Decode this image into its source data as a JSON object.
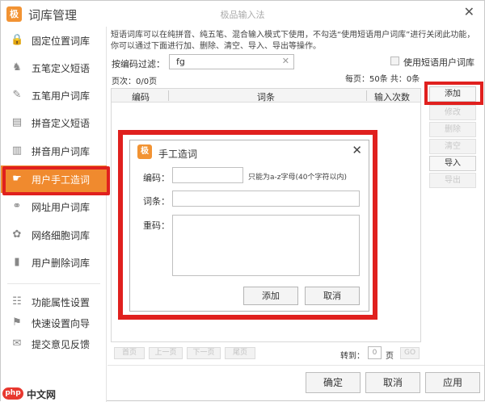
{
  "window": {
    "title": "词库管理",
    "logo": "极",
    "center_title": "极品输入法",
    "close_icon": "close-icon"
  },
  "sidebar": {
    "items": [
      {
        "label": "固定位置词库",
        "icon": "lock-icon",
        "glyph": "🔒"
      },
      {
        "label": "五笔定义短语",
        "icon": "person-icon",
        "glyph": "♞"
      },
      {
        "label": "五笔用户词库",
        "icon": "edit-icon",
        "glyph": "✎"
      },
      {
        "label": "拼音定义短语",
        "icon": "grid-icon",
        "glyph": "▤"
      },
      {
        "label": "拼音用户词库",
        "icon": "book-icon",
        "glyph": "▥"
      },
      {
        "label": "用户手工造词",
        "icon": "hand-icon",
        "glyph": "☛",
        "active": true
      },
      {
        "label": "网址用户词库",
        "icon": "link-icon",
        "glyph": "⚭"
      },
      {
        "label": "网络细胞词库",
        "icon": "cell-icon",
        "glyph": "✿"
      },
      {
        "label": "用户删除词库",
        "icon": "trash-icon",
        "glyph": "▮"
      },
      {
        "label": "功能属性设置",
        "icon": "settings-icon",
        "glyph": "☷"
      },
      {
        "label": "快速设置向导",
        "icon": "flag-icon",
        "glyph": "⚑"
      },
      {
        "label": "提交意见反馈",
        "icon": "feedback-icon",
        "glyph": "✉"
      }
    ],
    "colors": {
      "active_bg": "#f08a2e",
      "highlight": "#e0201e"
    }
  },
  "main": {
    "description": "短语词库可以在纯拼音、纯五笔、混合输入模式下使用，不勾选“使用短语用户词库”进行关闭此功能，你可以通过下面进行加、删除、清空、导入、导出等操作。",
    "filter_label": "按编码过滤：",
    "filter_value": "fg",
    "use_checkbox_label": "使用短语用户词库",
    "page_info": "页次：0/0页",
    "per_page": "每页：50条 共：0条",
    "columns": [
      "编码",
      "词条",
      "输入次数"
    ],
    "side_buttons": [
      {
        "label": "添加",
        "enabled": true
      },
      {
        "label": "修改",
        "enabled": false
      },
      {
        "label": "删除",
        "enabled": false
      },
      {
        "label": "清空",
        "enabled": false
      },
      {
        "label": "导入",
        "enabled": true
      },
      {
        "label": "导出",
        "enabled": false
      }
    ],
    "pager": {
      "first": "首页",
      "prev": "上一页",
      "next": "下一页",
      "last": "尾页",
      "goto_label": "转到：",
      "goto_value": "0",
      "page_word": "页",
      "go": "GO"
    }
  },
  "footer": {
    "ok": "确定",
    "cancel": "取消",
    "apply": "应用"
  },
  "dialog": {
    "title": "手工造词",
    "logo": "极",
    "code_label": "编码：",
    "code_hint": "只能为a-z字母(40个字符以内)",
    "word_label": "词条：",
    "reverse_label": "重码：",
    "add_button": "添加",
    "cancel_button": "取消"
  },
  "watermark": {
    "logo": "php",
    "text": "中文网"
  }
}
